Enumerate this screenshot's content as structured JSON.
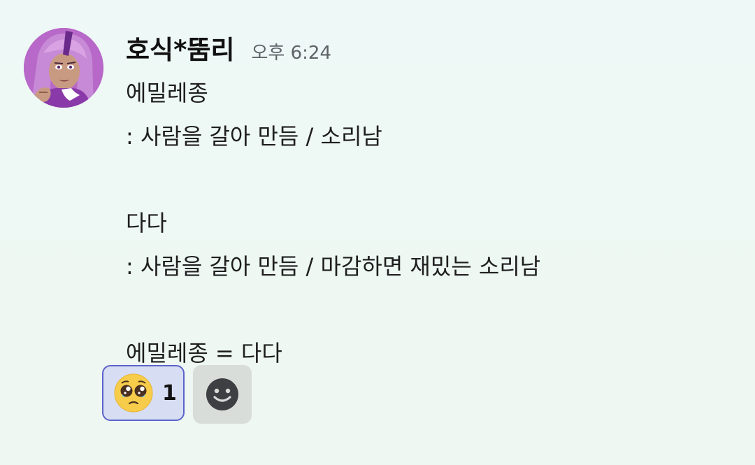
{
  "message": {
    "username": "호식*뚬리",
    "timestamp": "오후 6:24",
    "lines": [
      "에밀레종",
      ": 사람을 갈아 만듬 / 소리남",
      "",
      "다다",
      ": 사람을 갈아 만듬 / 마감하면 재밌는 소리남",
      "",
      "에밀레종 = 다다"
    ]
  },
  "reactions": [
    {
      "emoji": "pleading-face-emoji",
      "count": "1"
    }
  ],
  "add_reaction": {
    "icon": "smiley-face-icon"
  },
  "colors": {
    "background": "#eef8f6",
    "reaction_border": "#5b63c9",
    "reaction_bg": "#d7def3",
    "timestamp": "#5f6368"
  }
}
